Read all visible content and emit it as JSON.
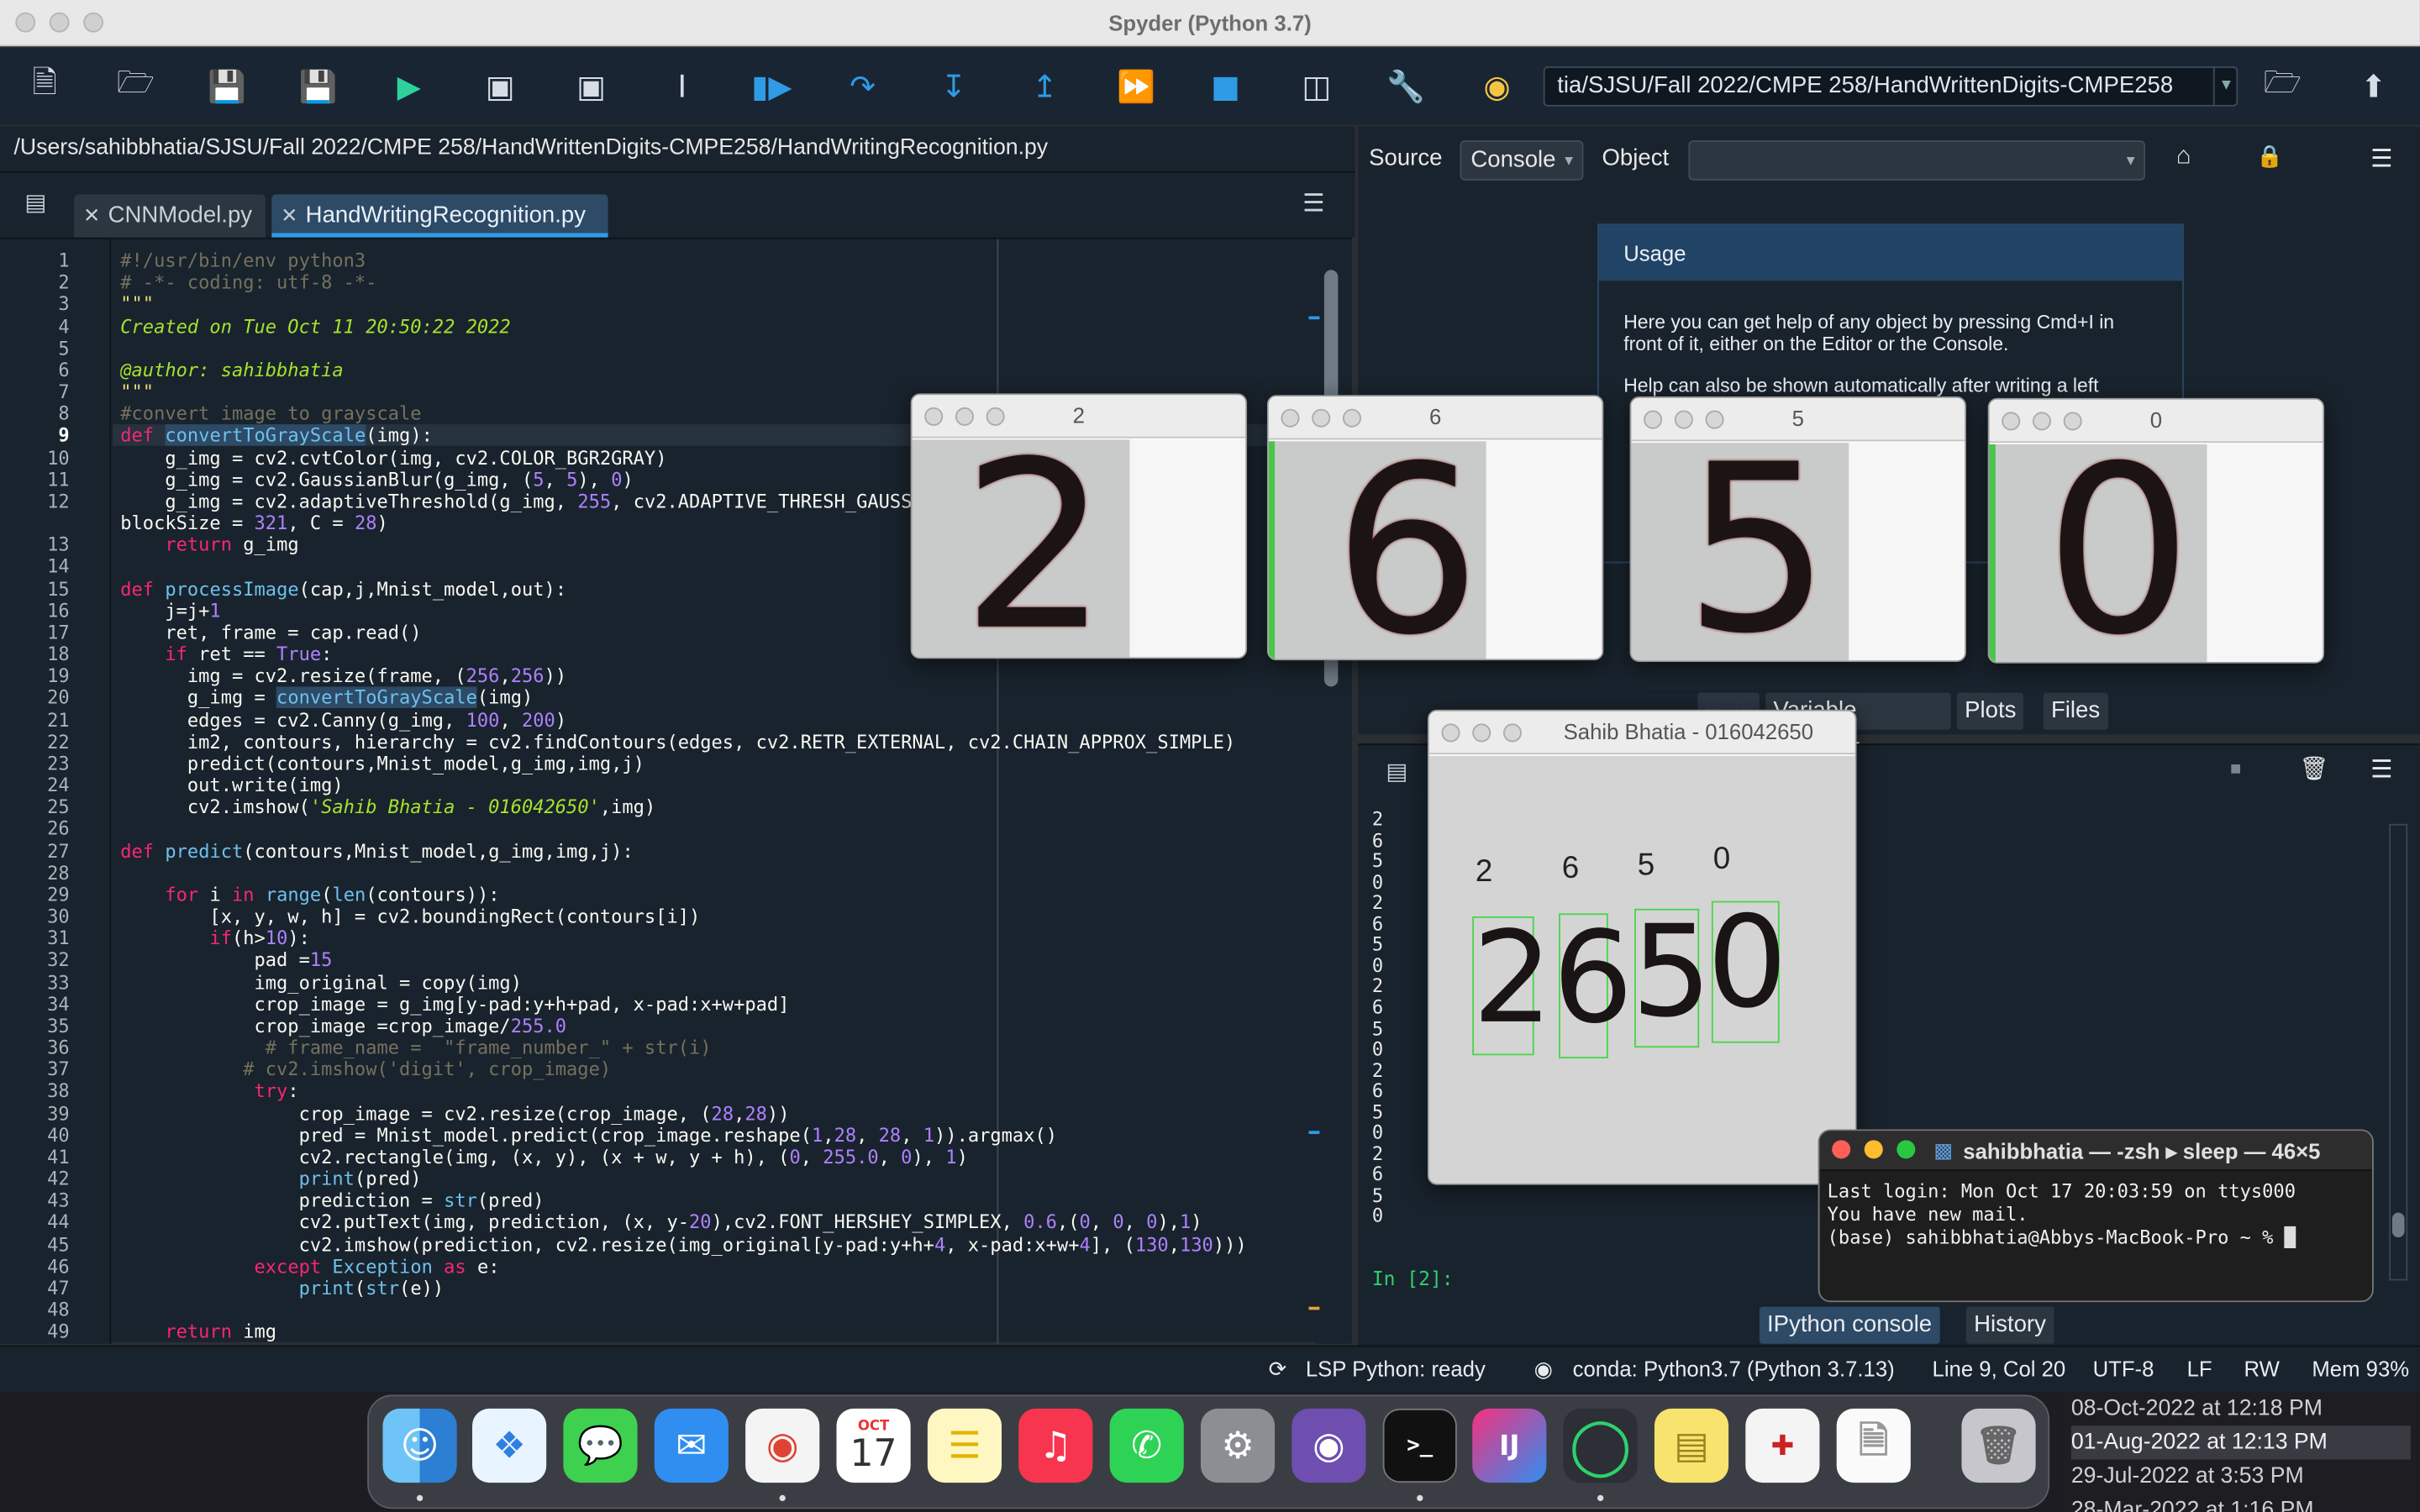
{
  "window": {
    "title": "Spyder (Python 3.7)"
  },
  "toolbar": {
    "working_dir": "tia/SJSU/Fall 2022/CMPE 258/HandWrittenDigits-CMPE258",
    "icons": [
      "new-file-icon",
      "open-file-icon",
      "save-icon",
      "save-all-icon",
      "run-icon",
      "run-cell-icon",
      "run-cell-advance-icon",
      "run-selection-icon",
      "debug-icon",
      "step-over-icon",
      "step-into-icon",
      "step-return-icon",
      "continue-icon",
      "stop-icon",
      "maximize-pane-icon",
      "preferences-icon",
      "python-path-icon"
    ]
  },
  "editor": {
    "file_path": "/Users/sahibbhatia/SJSU/Fall 2022/CMPE 258/HandWrittenDigits-CMPE258/HandWritingRecognition.py",
    "tabs": [
      {
        "label": "CNNModel.py"
      },
      {
        "label": "HandWritingRecognition.py"
      }
    ],
    "current_line": 9
  },
  "help": {
    "source_label": "Source",
    "source_value": "Console",
    "object_label": "Object",
    "object_value": "",
    "usage_title": "Usage",
    "usage_line1": "Here you can get help of any object by pressing Cmd+I in",
    "usage_line2": "front of it, either on the Editor or the Console.",
    "usage_line3": "Help can also be shown automatically after writing a left",
    "pane_tabs": [
      "Help",
      "Variable Explorer",
      "Plots",
      "Files"
    ]
  },
  "console": {
    "outputs": [
      "2",
      "6",
      "5",
      "0",
      "2",
      "6",
      "5",
      "0",
      "2",
      "6",
      "5",
      "0",
      "2",
      "6",
      "5",
      "0",
      "2",
      "6",
      "5",
      "0"
    ],
    "prompt": "In [2]:",
    "tabs": [
      "IPython console",
      "History"
    ]
  },
  "statusbar": {
    "lsp": "LSP Python: ready",
    "conda": "conda: Python3.7 (Python 3.7.13)",
    "position": "Line 9, Col 20",
    "encoding": "UTF-8",
    "eol": "LF",
    "permissions": "RW",
    "memory": "Mem 93%"
  },
  "digit_windows": [
    {
      "title": "2",
      "digit": "2"
    },
    {
      "title": "6",
      "digit": "6"
    },
    {
      "title": "5",
      "digit": "5"
    },
    {
      "title": "0",
      "digit": "0"
    }
  ],
  "main_frame": {
    "title": "Sahib Bhatia - 016042650",
    "predictions": [
      "2",
      "6",
      "5",
      "0"
    ],
    "digits": [
      "2",
      "6",
      "5",
      "0"
    ]
  },
  "terminal": {
    "title": "sahibbhatia — -zsh ▸ sleep — 46×5",
    "line1": "Last login: Mon Oct 17 20:03:59 on ttys000",
    "line2": "You have new mail.",
    "line3": "(base) sahibbhatia@Abbys-MacBook-Pro ~ % "
  },
  "dock": {
    "calendar_month": "OCT",
    "calendar_day": "17",
    "apps": [
      "finder",
      "safari",
      "messages",
      "mail",
      "chrome",
      "calendar",
      "notes",
      "music",
      "whatsapp",
      "system-preferences",
      "github-desktop",
      "terminal",
      "intellij",
      "jupyter",
      "stickies",
      "rstudio-text",
      "document",
      "trash"
    ]
  },
  "sidebar_dates": [
    "08-Oct-2022 at 12:18 PM",
    "01-Aug-2022 at 12:13 PM",
    "29-Jul-2022 at 3:53 PM",
    "28-Mar-2022 at 1:16 PM"
  ],
  "colors": {
    "accent": "#2f9be6",
    "editor_bg": "#19232d",
    "prompt": "#2ed16d"
  }
}
